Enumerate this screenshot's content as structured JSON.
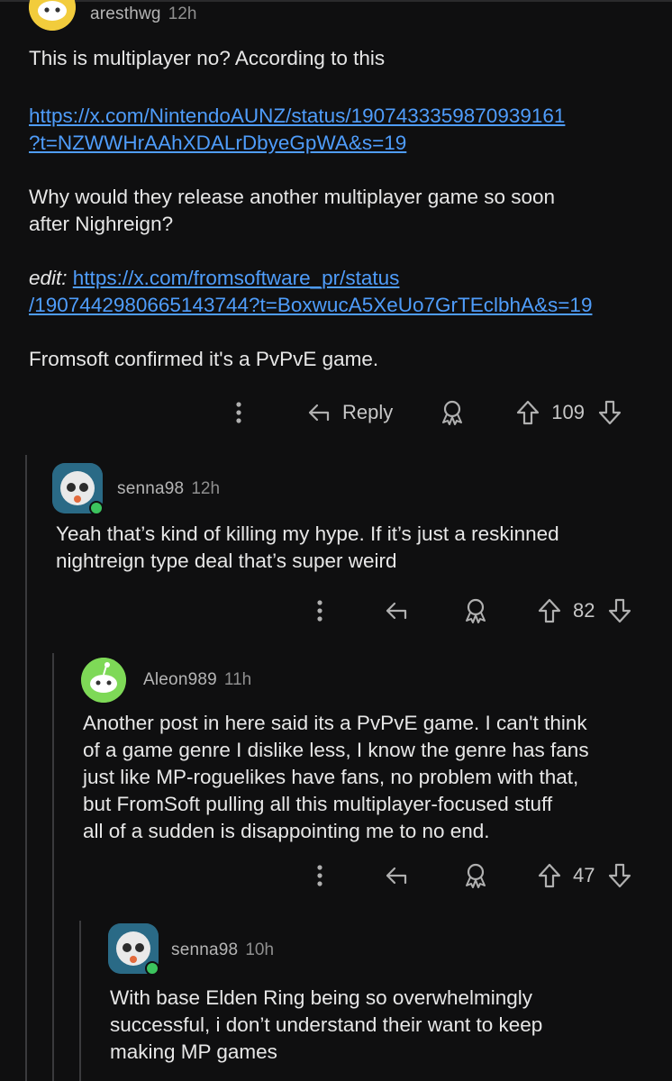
{
  "comments": [
    {
      "author": "aresthwg",
      "time": "12h",
      "paragraphs": {
        "p1": "This is multiplayer no? According to this",
        "link1_line1": "https://x.com/NintendoAUNZ/status/1907433359870939161",
        "link1_line2": "?t=NZWWHrAAhXDALrDbyeGpWA&s=19",
        "p2_line1": "Why would they release another multiplayer game so soon",
        "p2_line2": "after Nighreign?",
        "edit_label": "edit:",
        "link2_line1": "https://x.com/fromsoftware_pr/status",
        "link2_line2": "/1907442980665143744?t=BoxwucA5XeUo7GrTEclbhA&s=19",
        "p3": "Fromsoft confirmed it's a PvPvE game."
      },
      "reply_label": "Reply",
      "score": "109"
    },
    {
      "author": "senna98",
      "time": "12h",
      "lines": [
        "Yeah that’s kind of killing my hype. If it’s just a reskinned",
        "nightreign type deal that’s super weird"
      ],
      "score": "82"
    },
    {
      "author": "Aleon989",
      "time": "11h",
      "lines": [
        "Another post in here said its a PvPvE game. I can't think",
        "of a game genre I dislike less, I know the genre has fans",
        "just like MP-roguelikes have fans, no problem with that,",
        "but FromSoft pulling all this multiplayer-focused stuff",
        "all of a sudden is disappointing me to no end."
      ],
      "score": "47"
    },
    {
      "author": "senna98",
      "time": "10h",
      "lines": [
        "With base Elden Ring being so overwhelmingly",
        "successful, i don’t understand their want to keep",
        "making MP games"
      ]
    }
  ],
  "icons": {
    "more": "more-vertical-icon",
    "reply": "reply-arrow-icon",
    "award": "award-icon",
    "upvote": "upvote-icon",
    "downvote": "downvote-icon"
  },
  "colors": {
    "background": "#0f0f10",
    "link": "#4f9dfb",
    "online": "#3cc45e",
    "avatar_yellow": "#f2cc3c",
    "avatar_green": "#7ed957"
  }
}
